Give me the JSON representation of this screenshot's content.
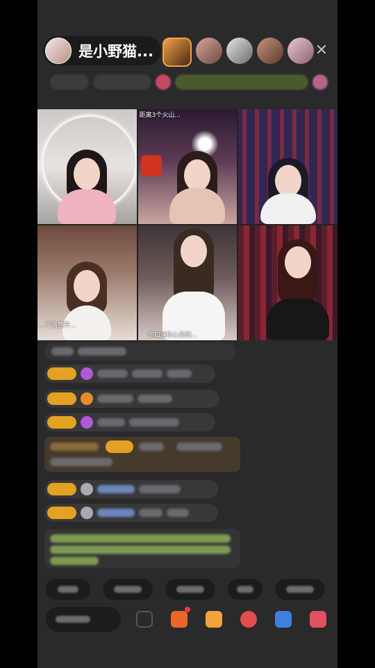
{
  "header": {
    "host_name": "是小野猫..."
  },
  "video_tiles": [
    {
      "label": ""
    },
    {
      "label": "距离3个火山..."
    },
    {
      "label": ""
    },
    {
      "label": "...不满意开..."
    },
    {
      "label": "你知道你心爱的..."
    },
    {
      "label": ""
    }
  ],
  "colors": {
    "badge": "#e2a224",
    "gem_purple": "#b05ad6",
    "gem_orange": "#e88b2e",
    "gem_gray": "#a9a9b3",
    "panel": "#2a2a2c"
  },
  "icons": [
    "close-icon",
    "gift-icon",
    "more-icon",
    "shop-icon",
    "game-icon",
    "share-icon"
  ]
}
